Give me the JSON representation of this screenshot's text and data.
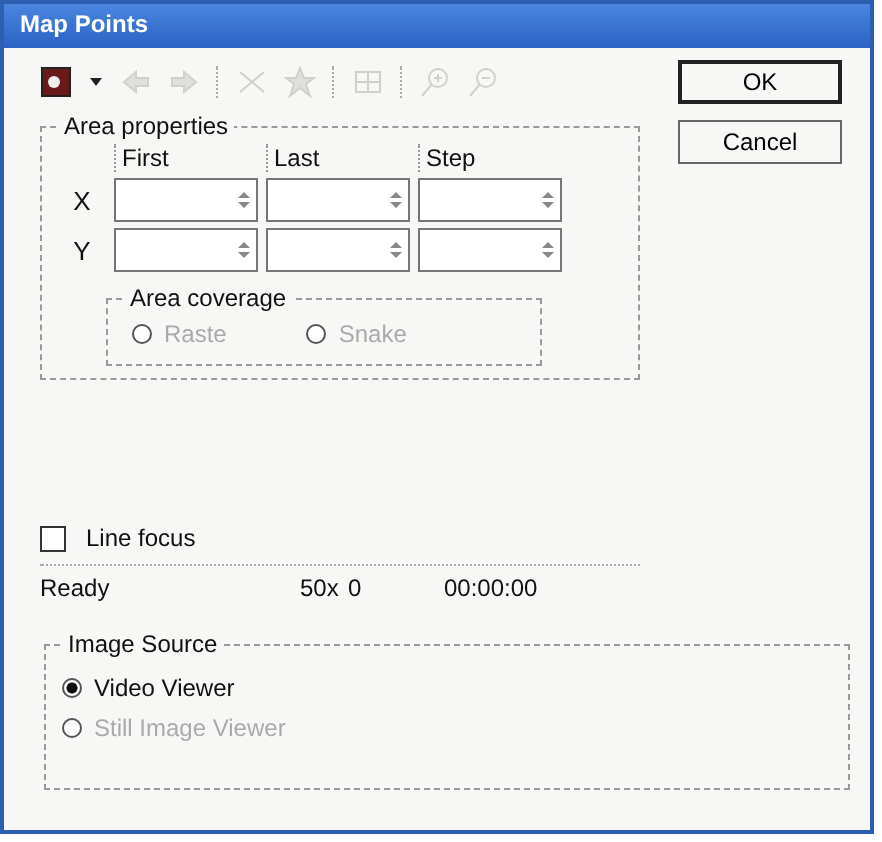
{
  "window": {
    "title": "Map Points"
  },
  "toolbar": {
    "items": [
      {
        "kind": "record",
        "disabled": false
      },
      {
        "kind": "caret",
        "disabled": false
      },
      {
        "kind": "back",
        "disabled": true
      },
      {
        "kind": "forward",
        "disabled": true
      },
      {
        "kind": "sep"
      },
      {
        "kind": "cut",
        "disabled": true
      },
      {
        "kind": "clear",
        "disabled": true
      },
      {
        "kind": "sep"
      },
      {
        "kind": "grid",
        "disabled": true
      },
      {
        "kind": "sep"
      },
      {
        "kind": "zoomin",
        "disabled": true
      },
      {
        "kind": "zoomout",
        "disabled": true
      }
    ]
  },
  "buttons": [
    {
      "label": "OK",
      "default": true
    },
    {
      "label": "Cancel",
      "default": false
    }
  ],
  "area_properties": {
    "title": "Area properties",
    "columns": [
      "First",
      "Last",
      "Step"
    ],
    "rows": [
      {
        "label": "X"
      },
      {
        "label": "Y"
      }
    ],
    "coverage": {
      "title": "Area coverage",
      "options": [
        {
          "label": "Raste",
          "selected": false,
          "disabled": true
        },
        {
          "label": "Snake",
          "selected": false,
          "disabled": true
        }
      ]
    }
  },
  "line_focus": {
    "label": "Line focus",
    "checked": false
  },
  "status_bar": [
    "Ready",
    "50x",
    "0",
    "00:00:00"
  ],
  "image_source": {
    "title": "Image Source",
    "options": [
      {
        "label": "Video Viewer",
        "selected": true,
        "disabled": false
      },
      {
        "label": "Still Image Viewer",
        "selected": false,
        "disabled": true
      }
    ]
  }
}
